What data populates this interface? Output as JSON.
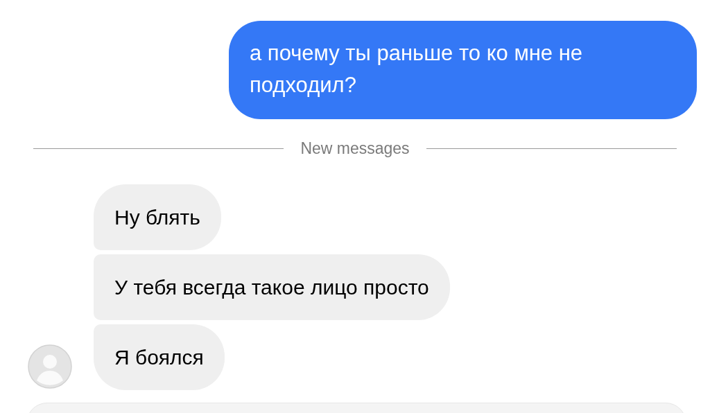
{
  "messages": [
    {
      "kind": "sent",
      "text": "а почему ты раньше то ко мне не подходил?"
    },
    {
      "kind": "divider",
      "text": "New messages"
    },
    {
      "kind": "received",
      "text": "Ну блять",
      "avatar": false
    },
    {
      "kind": "received",
      "text": "У тебя всегда такое лицо просто",
      "avatar": false
    },
    {
      "kind": "received",
      "text": "Я боялся",
      "avatar": true
    }
  ],
  "composer": {
    "kind": "field"
  }
}
